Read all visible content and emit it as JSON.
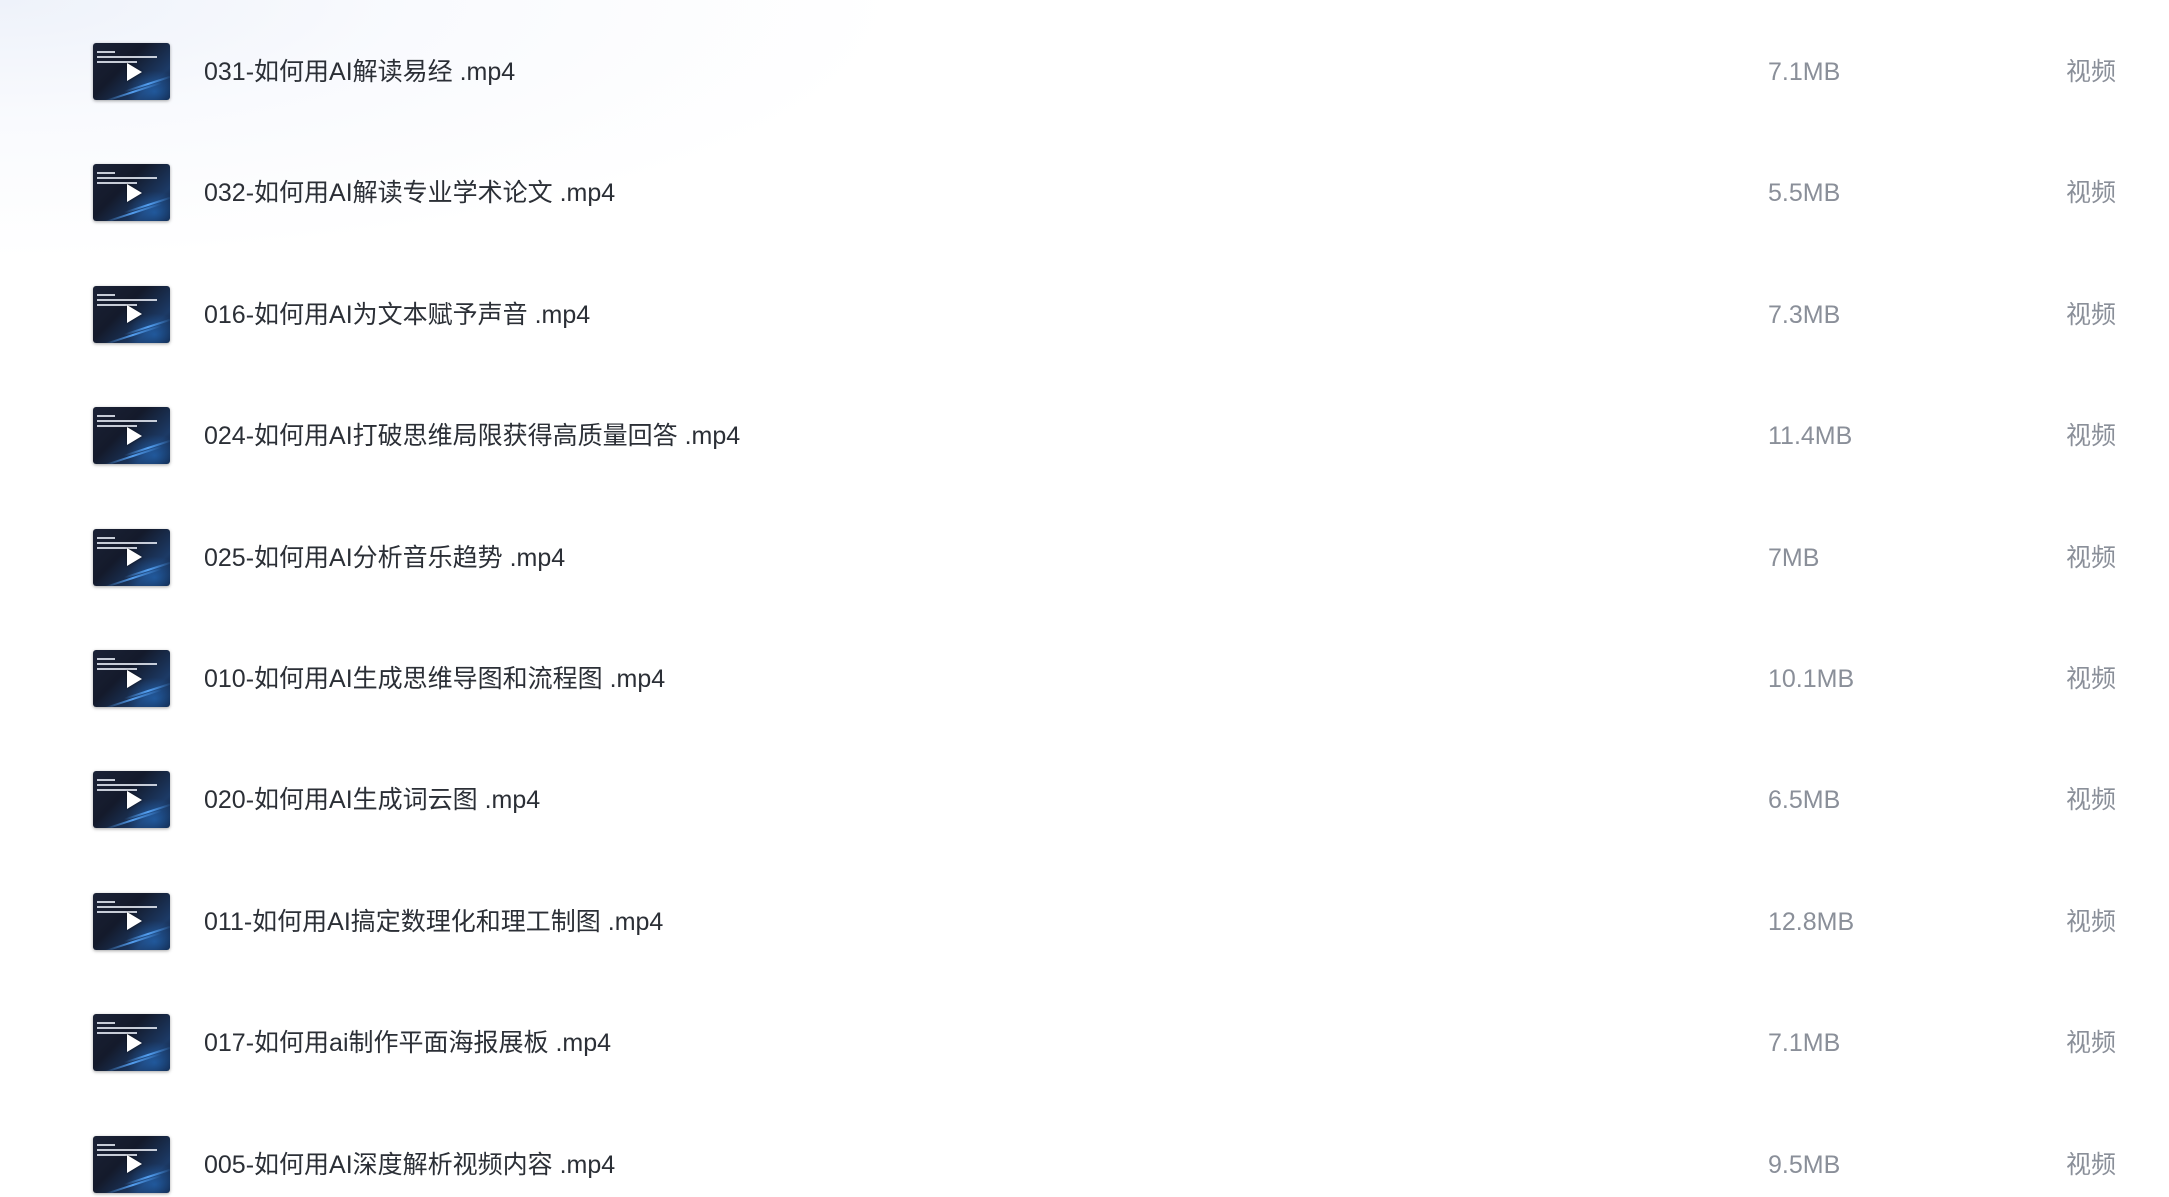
{
  "files": [
    {
      "name": "031-如何用AI解读易经 .mp4",
      "size": "7.1MB",
      "type": "视频",
      "thumbnail_icon": "video-play-icon"
    },
    {
      "name": "032-如何用AI解读专业学术论文 .mp4",
      "size": "5.5MB",
      "type": "视频",
      "thumbnail_icon": "video-play-icon"
    },
    {
      "name": "016-如何用AI为文本赋予声音 .mp4",
      "size": "7.3MB",
      "type": "视频",
      "thumbnail_icon": "video-play-icon"
    },
    {
      "name": "024-如何用AI打破思维局限获得高质量回答 .mp4",
      "size": "11.4MB",
      "type": "视频",
      "thumbnail_icon": "video-play-icon"
    },
    {
      "name": "025-如何用AI分析音乐趋势 .mp4",
      "size": "7MB",
      "type": "视频",
      "thumbnail_icon": "video-play-icon"
    },
    {
      "name": "010-如何用AI生成思维导图和流程图 .mp4",
      "size": "10.1MB",
      "type": "视频",
      "thumbnail_icon": "video-play-icon"
    },
    {
      "name": "020-如何用AI生成词云图 .mp4",
      "size": "6.5MB",
      "type": "视频",
      "thumbnail_icon": "video-play-icon"
    },
    {
      "name": "011-如何用AI搞定数理化和理工制图 .mp4",
      "size": "12.8MB",
      "type": "视频",
      "thumbnail_icon": "video-play-icon"
    },
    {
      "name": "017-如何用ai制作平面海报展板 .mp4",
      "size": "7.1MB",
      "type": "视频",
      "thumbnail_icon": "video-play-icon"
    },
    {
      "name": "005-如何用AI深度解析视频内容 .mp4",
      "size": "9.5MB",
      "type": "视频",
      "thumbnail_icon": "video-play-icon"
    }
  ]
}
